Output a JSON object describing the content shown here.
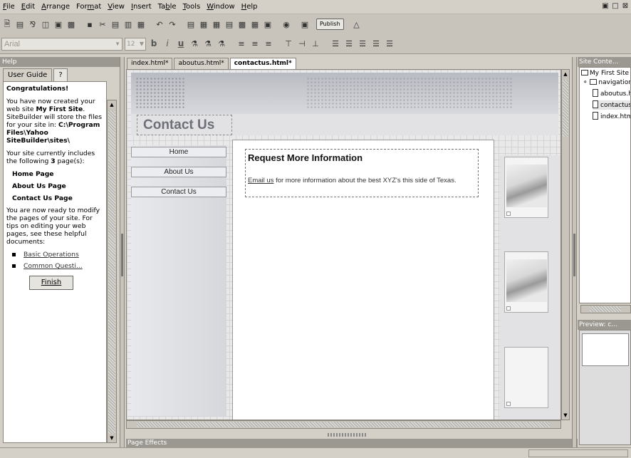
{
  "menu": [
    "File",
    "Edit",
    "Arrange",
    "Format",
    "View",
    "Insert",
    "Table",
    "Tools",
    "Window",
    "Help"
  ],
  "menu_underline": [
    "F",
    "E",
    "A",
    "m",
    "V",
    "I",
    "b",
    "T",
    "W",
    "H"
  ],
  "toolbar": {
    "publish_label": "Publish"
  },
  "format": {
    "font_value": "Arial",
    "size_value": "12",
    "bold": "b",
    "italic": "i",
    "underline": "u"
  },
  "help": {
    "panel_title": "Help",
    "tabs": [
      "User Guide",
      "?"
    ],
    "heading": "Congratulations!",
    "p1_pre": "You have now created your web site ",
    "p1_site": "My First Site",
    "p1_mid": ". SiteBuilder will store the files for your site in: ",
    "p1_path": "C:\\Program Files\\Yahoo SiteBuilder\\sites\\",
    "p2_pre": "Your site currently includes the following ",
    "p2_count": "3",
    "p2_post": " page(s):",
    "pages": [
      "Home Page",
      "About Us Page",
      "Contact Us Page"
    ],
    "p3": "You are now ready to modify the pages of your site. For tips on editing your web pages, see these helpful documents:",
    "links": [
      "Basic Operations",
      "Common Questi..."
    ],
    "finish_label": "Finish"
  },
  "doc_tabs": [
    "index.html*",
    "aboutus.html*",
    "contactus.html*"
  ],
  "page": {
    "title": "Contact Us",
    "nav": [
      "Home",
      "About Us",
      "Contact Us"
    ],
    "request_title": "Request More Information",
    "email_link": "Email us",
    "request_text": " for more information about the best XYZ's this side of Texas."
  },
  "bottom": {
    "page_effects": "Page Effects"
  },
  "site": {
    "panel_title": "Site Conte...",
    "root": "My First Site",
    "folder": "navigation",
    "files": [
      "aboutus.html",
      "contactus.html",
      "index.html"
    ]
  },
  "preview": {
    "panel_title": "Preview: c..."
  }
}
